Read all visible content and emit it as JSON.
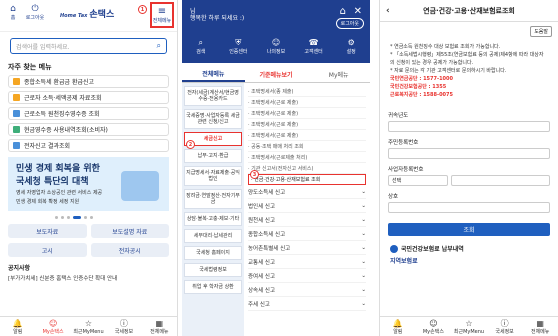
{
  "panel1": {
    "top_buttons": [
      "홈",
      "로그아웃"
    ],
    "logo_small": "Home Tax",
    "logo_main": "손택스",
    "menu_label": "전체메뉴",
    "search_placeholder": "검색어를 입력하세요.",
    "faq_title": "자주 찾는 메뉴",
    "faq_items": [
      {
        "label": "종합소득세 환급금 환급신고",
        "color": "#f5a623"
      },
      {
        "label": "근로자 소득·세액공제 자료조회",
        "color": "#f5a623"
      },
      {
        "label": "근로소득 원천징수영수증 조회",
        "color": "#4a90d9"
      },
      {
        "label": "현금영수증 사용내역조회(소비자)",
        "color": "#3fae7a"
      },
      {
        "label": "전자신고 결과조회",
        "color": "#4a90d9"
      }
    ],
    "banner_l1": "민생 경제 회복을 위한",
    "banner_l2": "국세청 특단의 대책",
    "banner_l3": "영세 자영업자 소상공인 관련 서비스 제공",
    "banner_l4": "민생 경제 회복 확정 세정 지원",
    "grid_buttons": [
      "보도자료",
      "보도설명 자료",
      "고시",
      "전자공시"
    ],
    "notice_title": "공지사항",
    "notice_text": "[부가가치세] 신분증 홈택스 인증수단 확대 안내",
    "bottom_nav": [
      "알림",
      "My손택스",
      "최근MyMenu",
      "국세정보",
      "전체메뉴"
    ]
  },
  "panel2": {
    "name": "님",
    "greeting": "행복한 하루 되세요 :)",
    "logout": "로그아웃",
    "quick": [
      "검색",
      "인증센터",
      "나의정보",
      "고객센터",
      "설정"
    ],
    "tabs": [
      "전체메뉴",
      "기준메뉴보기",
      "My메뉴"
    ],
    "left_items": [
      "전자(세금)계산서/현금영수증·전용카드",
      "국세증명·사업자등록 세금관련 신청/신고",
      "세금신고",
      "납부·고지·환급",
      "지급명세서·자료제출·공익법인",
      "장려금·연말정산·전자기부금",
      "상담·불복·고충·제보·기타",
      "세무대리·납세관리",
      "국세청 홈페이지",
      "국세법령정보",
      "취업 후 학자금 상환"
    ],
    "right_items": [
      "· 조택명세서(종 제출)",
      "· 조택명세서(근로 제출)",
      "· 조택명세서(근로 제출)",
      "· 조택명세서(근로 제출)",
      "· 조택명세서(근로 제출)",
      "· 공동·조택 매매 처리 조회",
      "· 조택명세서(근로제출 처리)",
      "· 기관 신고서(전자신고 서비스)",
      "· 연금·건강·고용·산재보험료 조회"
    ],
    "right_groups": [
      "양도소득세 신고",
      "법인세 신고",
      "원천세 신고",
      "종합소득세 신고",
      "농어촌특별세 신고",
      "교통세 신고",
      "증여세 신고",
      "상속세 신고",
      "주세 신고"
    ],
    "markers": [
      "1",
      "2",
      "3"
    ]
  },
  "panel3": {
    "title": "연금·건강·고용·산재보험료조회",
    "tool": "도움말",
    "desc1": "* 연금소득 원천징수 대상 보험료 조회가 가능합니다.",
    "desc2": "* 「소득세법시행령」제55조(연금보험료 등의 공제)제4항에 따라 대상자의 신청이 있는 경우 공제가 가능합니다.",
    "desc3": "* 자료 문의는 각 기관 고객센터로 문의하시기 바랍니다.",
    "contact1": "국민연금공단 : 1577-1000",
    "contact2": "국민건강보험공단 : 1355",
    "contact3": "근로복지공단 : 1588-0075",
    "year_label": "귀속년도",
    "rrn_label": "주민등록번호",
    "biz_label": "사업자등록번호",
    "biz_select": "선택",
    "name_label": "상호",
    "query_btn": "조회",
    "sec1": "국민건강보험료 납부내역",
    "sec2": "지역보험료"
  }
}
